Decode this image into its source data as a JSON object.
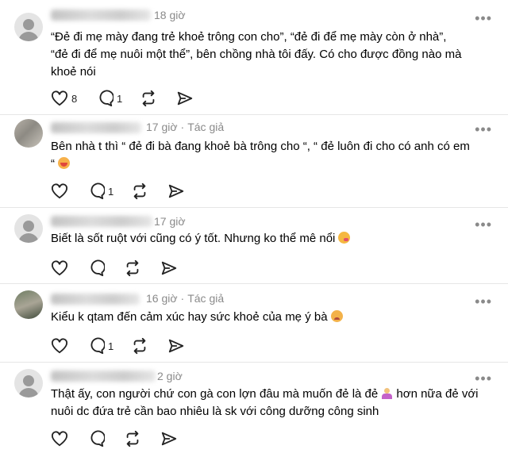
{
  "comments": [
    {
      "avatar": "default-avatar-icon",
      "time": "18 giờ",
      "author_tag": "",
      "text_lines": [
        "“Đẻ đi mẹ mày đang trẻ khoẻ trông con cho”, “đẻ đi để mẹ mày còn ở nhà”,",
        "“đẻ đi để mẹ nuôi một thể”, bên chồng nhà tôi đấy. Có cho được đồng nào mà",
        "khoẻ nói"
      ],
      "likes": "8",
      "replies": "1"
    },
    {
      "avatar": "photo-avatar",
      "time": "17 giờ",
      "author_tag": "Tác giả",
      "text_lines": [
        "Bên nhà t thì “ đẻ đi bà đang khoẻ bà trông cho “, “ đẻ luôn đi cho có anh có em",
        "“"
      ],
      "emoji": "hot-face-emoji",
      "likes": "",
      "replies": "1"
    },
    {
      "avatar": "default-avatar-icon",
      "time": "17 giờ",
      "author_tag": "",
      "text_lines": [
        "Biết là sốt ruột với cũng có ý tốt. Nhưng ko thể mê nổi"
      ],
      "emoji": "face-savoring-emoji",
      "likes": "",
      "replies": ""
    },
    {
      "avatar": "photo-avatar",
      "time": "16 giờ",
      "author_tag": "Tác giả",
      "text_lines": [
        "Kiểu k qtam đến cảm xúc hay sức khoẻ của mẹ ý bà"
      ],
      "emoji": "pleading-face-emoji",
      "likes": "",
      "replies": "1"
    },
    {
      "avatar": "default-avatar-icon",
      "time": "2 giờ",
      "author_tag": "",
      "text_lines": [
        "Thật ấy, con người chứ con gà con lợn đâu mà muốn đẻ là đẻ",
        "hơn nữa đẻ với",
        "nuôi dc đứa trẻ cần bao nhiêu là sk với công dưỡng công sinh"
      ],
      "emoji": "person-shrugging-emoji",
      "likes": "",
      "replies": ""
    }
  ],
  "more_label": "•••"
}
